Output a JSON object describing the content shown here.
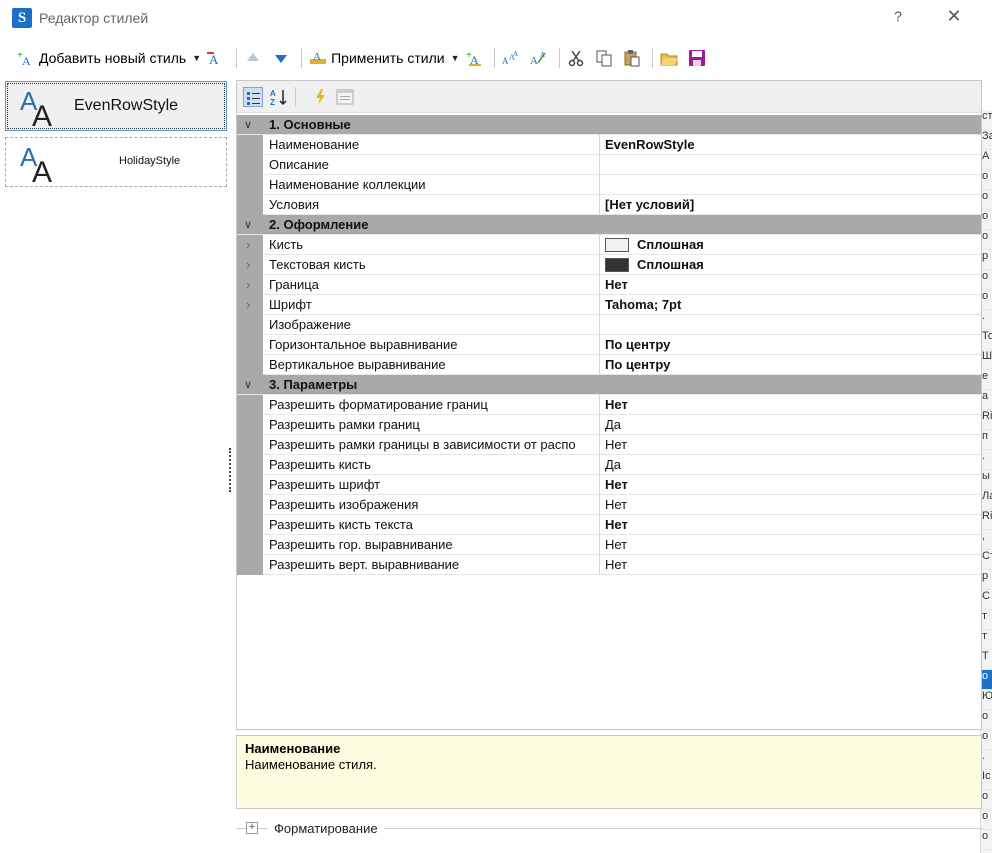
{
  "window": {
    "title": "Редактор стилей",
    "help": "?",
    "close": "✕"
  },
  "toolbar": {
    "add_style": "Добавить новый стиль",
    "apply_styles": "Применить стили"
  },
  "styles": [
    {
      "name": "EvenRowStyle",
      "selected": true
    },
    {
      "name": "HolidayStyle",
      "selected": false
    }
  ],
  "grid": {
    "categories": {
      "basic": "1. Основные",
      "design": "2. Оформление",
      "params": "3. Параметры"
    },
    "basic": [
      {
        "name": "Наименование",
        "value": "EvenRowStyle",
        "bold": true
      },
      {
        "name": "Описание",
        "value": ""
      },
      {
        "name": "Наименование коллекции",
        "value": ""
      },
      {
        "name": "Условия",
        "value": "[Нет условий]",
        "bold": true
      }
    ],
    "design": [
      {
        "name": "Кисть",
        "value": "Сплошная",
        "bold": true,
        "expand": true,
        "swatch": "#f2f2f2"
      },
      {
        "name": "Текстовая кисть",
        "value": "Сплошная",
        "bold": true,
        "expand": true,
        "swatch": "#333333"
      },
      {
        "name": "Граница",
        "value": "Нет",
        "bold": true,
        "expand": true
      },
      {
        "name": "Шрифт",
        "value": "Tahoma; 7pt",
        "bold": true,
        "expand": true
      },
      {
        "name": "Изображение",
        "value": ""
      },
      {
        "name": "Горизонтальное выравнивание",
        "value": "По центру",
        "bold": true
      },
      {
        "name": "Вертикальное выравнивание",
        "value": "По центру",
        "bold": true
      }
    ],
    "params": [
      {
        "name": "Разрешить форматирование границ",
        "value": "Нет",
        "bold": true
      },
      {
        "name": "Разрешить рамки границ",
        "value": "Да"
      },
      {
        "name": "Разрешить рамки границы в зависимости от распо",
        "value": "Нет"
      },
      {
        "name": "Разрешить кисть",
        "value": "Да"
      },
      {
        "name": "Разрешить шрифт",
        "value": "Нет",
        "bold": true
      },
      {
        "name": "Разрешить изображения",
        "value": "Нет"
      },
      {
        "name": "Разрешить кисть текста",
        "value": "Нет",
        "bold": true
      },
      {
        "name": "Разрешить гор. выравнивание",
        "value": "Нет"
      },
      {
        "name": "Разрешить верт. выравнивание",
        "value": "Нет"
      }
    ]
  },
  "description": {
    "title": "Наименование",
    "text": "Наименование стиля."
  },
  "bottom_group": {
    "label": "Форматирование"
  },
  "background_window_fragments": [
    "ст",
    "За",
    "А",
    "о",
    "о",
    "о",
    "о",
    "р",
    "о",
    "о",
    ".",
    "То",
    "Ш",
    "е",
    "а",
    "Ri",
    "п",
    ".",
    "ы",
    "Ла",
    "Ri",
    ",",
    "Ст",
    "р",
    "С",
    "т",
    "т",
    "Т",
    "о",
    "Ю",
    "о",
    "о",
    ".",
    "Ic",
    "о",
    "о",
    "о",
    "о",
    "о"
  ],
  "colors": {
    "accent": "#1b6fc4",
    "category_bg": "#a9a9a9",
    "desc_bg": "#fffde0"
  }
}
